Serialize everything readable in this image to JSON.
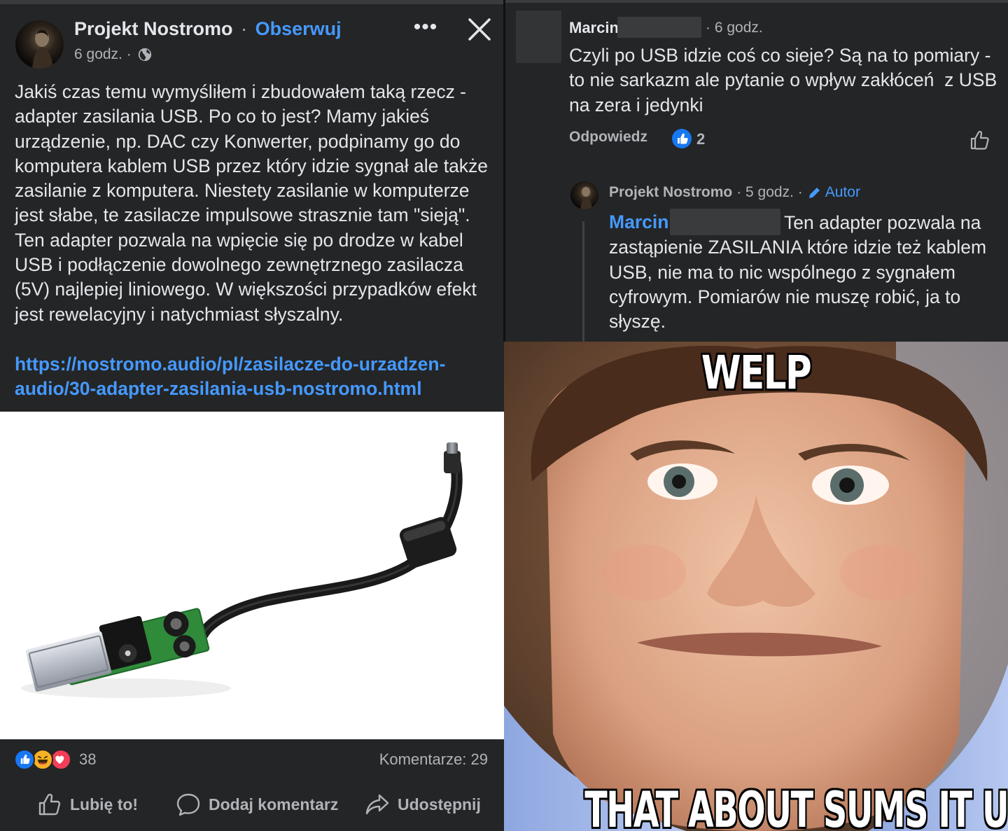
{
  "post": {
    "author": "Projekt Nostromo",
    "separator": "·",
    "follow": "Obserwuj",
    "time": "6 godz. ·",
    "text": "Jakiś czas temu wymyśliłem i zbudowałem taką rzecz - adapter zasilania USB. Po co to jest? Mamy jakieś urządzenie, np. DAC czy Konwerter, podpinamy go do komputera kablem USB przez który idzie sygnał ale także zasilanie z komputera. Niestety zasilanie w komputerze jest słabe, te zasilacze impulsowe strasznie tam \"sieją\". Ten adapter pozwala na wpięcie się po drodze w kabel USB i podłączenie dowolnego zewnętrznego zasilacza (5V) najlepiej liniowego. W większości przypadków efekt jest rewelacyjny i natychmiast słyszalny.",
    "link": "https://nostromo.audio/pl/zasilacze-do-urzadzen-audio/30-adapter-zasilania-usb-nostromo.html",
    "reaction_count": "38",
    "comments_count": "Komentarze: 29",
    "actions": {
      "like": "Lubię to!",
      "comment": "Dodaj komentarz",
      "share": "Udostępnij"
    },
    "reaction_icons": [
      "like-reaction-icon",
      "haha-reaction-icon",
      "love-reaction-icon"
    ]
  },
  "comments": [
    {
      "author": "Marcin",
      "time": "· 6 godz.",
      "text": "Czyli po USB idzie coś co sieje? Są na to pomiary - to nie sarkazm ale pytanie o wpływ zakłóceń  z USB na zera i jedynki",
      "reply_label": "Odpowiedz",
      "likes": "2"
    },
    {
      "author": "Projekt Nostromo",
      "time": "· 5 godz. ·",
      "badge": "Autor",
      "mention": "Marcin",
      "text": "Ten adapter pozwala na zastąpienie ZASILANIA które idzie też kablem USB, nie ma to nic wspólnego z sygnałem cyfrowym. Pomiarów nie muszę robić, ja to słyszę."
    }
  ],
  "meme": {
    "top_text": "WELP",
    "bottom_text": "THAT ABOUT SUMS IT UP"
  },
  "colors": {
    "background": "#242526",
    "link": "#4599ff",
    "text": "#e4e6eb",
    "secondary_text": "#b0b3b8",
    "like_blue": "#1877f2",
    "love_red": "#f33e58",
    "haha_yellow": "#f7b125"
  }
}
